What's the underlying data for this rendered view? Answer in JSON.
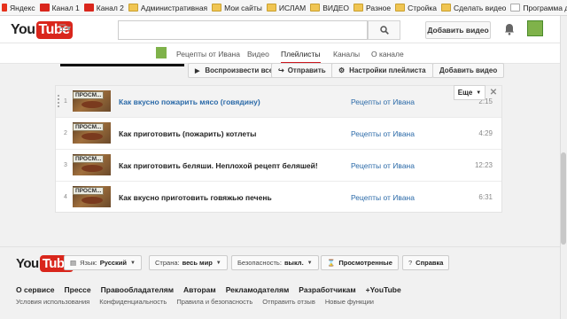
{
  "bookmarks": [
    {
      "label": "Яндекс",
      "icon": "yandex-icon"
    },
    {
      "label": "Канал 1",
      "icon": "youtube-icon"
    },
    {
      "label": "Канал 2",
      "icon": "youtube-icon"
    },
    {
      "label": "Административная",
      "icon": "folder-icon"
    },
    {
      "label": "Мои сайты",
      "icon": "folder-icon"
    },
    {
      "label": "ИСЛАМ",
      "icon": "folder-icon"
    },
    {
      "label": "ВИДЕО",
      "icon": "folder-icon"
    },
    {
      "label": "Разное",
      "icon": "folder-icon"
    },
    {
      "label": "Стройка",
      "icon": "folder-icon"
    },
    {
      "label": "Сделать видео",
      "icon": "folder-icon"
    },
    {
      "label": "Программа для расс...",
      "icon": "google-icon"
    }
  ],
  "header": {
    "logo_you": "You",
    "logo_tube": "Tube",
    "search_placeholder": "",
    "add_video": "Добавить видео"
  },
  "nav": {
    "tabs": [
      "Рецепты от Ивана",
      "Видео",
      "Плейлисты",
      "Каналы",
      "О канале"
    ],
    "selected": "Плейлисты"
  },
  "actions": {
    "play_all": "Воспроизвести все",
    "share": "Отправить",
    "settings": "Настройки плейлиста",
    "add_video": "Добавить видео",
    "more": "Еще"
  },
  "videos": [
    {
      "num": "1",
      "thumb": "ПРОСМ...",
      "title": "Как вкусно пожарить мясо (говядину)",
      "channel": "Рецепты от Ивана",
      "duration": "2:15"
    },
    {
      "num": "2",
      "thumb": "ПРОСМ...",
      "title": "Как приготовить (пожарить) котлеты",
      "channel": "Рецепты от Ивана",
      "duration": "4:29"
    },
    {
      "num": "3",
      "thumb": "ПРОСМ...",
      "title": "Как приготовить беляши. Неплохой рецепт беляшей!",
      "channel": "Рецепты от Ивана",
      "duration": "12:23"
    },
    {
      "num": "4",
      "thumb": "ПРОСМ...",
      "title": "Как вкусно приготовить говяжью печень",
      "channel": "Рецепты от Ивана",
      "duration": "6:31"
    }
  ],
  "footer": {
    "language_label": "Язык:",
    "language_value": "Русский",
    "country_label": "Страна:",
    "country_value": "весь мир",
    "safety_label": "Безопасность:",
    "safety_value": "выкл.",
    "history": "Просмотренные",
    "help": "Справка",
    "links": [
      "О сервисе",
      "Прессе",
      "Правообладателям",
      "Авторам",
      "Рекламодателям",
      "Разработчикам",
      "+YouTube"
    ],
    "links2": [
      "Условия использования",
      "Конфиденциальность",
      "Правила и безопасность",
      "Отправить отзыв",
      "Новые функции"
    ]
  },
  "colors": {
    "accent": "#cc181e",
    "link": "#2b6aa8"
  }
}
